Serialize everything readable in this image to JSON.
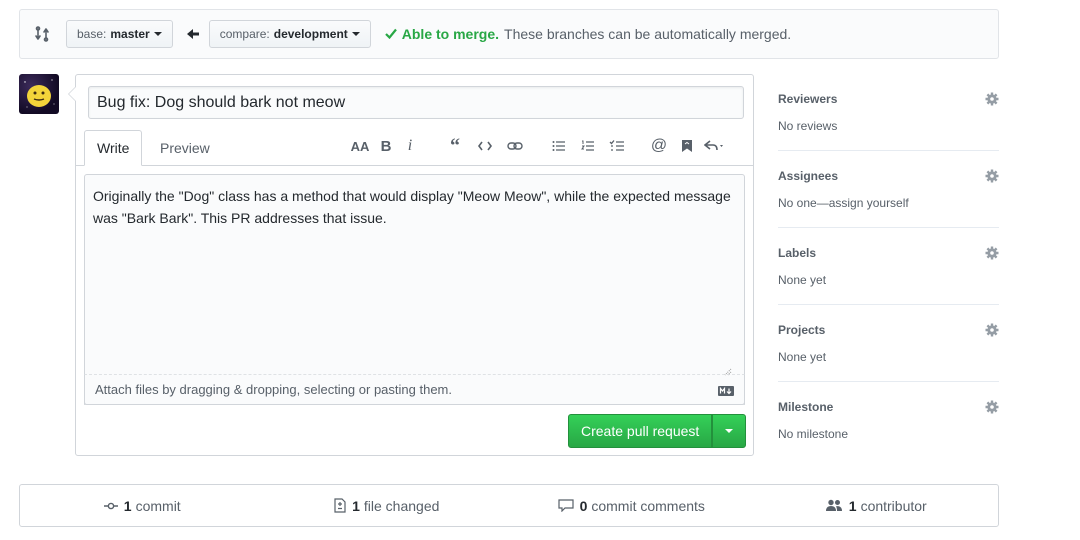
{
  "compare": {
    "base_label": "base:",
    "base_branch": "master",
    "compare_label": "compare:",
    "compare_branch": "development",
    "status_title": "Able to merge.",
    "status_desc": "These branches can be automatically merged.",
    "status_color": "#28a745"
  },
  "form": {
    "title_value": "Bug fix: Dog should bark not meow",
    "tabs": [
      {
        "label": "Write",
        "active": true
      },
      {
        "label": "Preview",
        "active": false
      }
    ],
    "toolbar": [
      "header-icon",
      "bold-icon",
      "italic-icon",
      "quote-icon",
      "code-icon",
      "link-icon",
      "bullet-list-icon",
      "numbered-list-icon",
      "task-list-icon",
      "mention-icon",
      "saved-reply-icon",
      "reply-icon"
    ],
    "body_text": "Originally the \"Dog\" class has a method that would display \"Meow Meow\", while the expected message was \"Bark Bark\". This PR addresses that issue.",
    "attach_text": "Attach files by dragging & dropping, selecting or pasting them.",
    "create_label": "Create pull request",
    "create_color": "#28a745"
  },
  "sidebar": {
    "sections": [
      {
        "title": "Reviewers",
        "value": "No reviews"
      },
      {
        "title": "Assignees",
        "value": "No one—assign yourself"
      },
      {
        "title": "Labels",
        "value": "None yet"
      },
      {
        "title": "Projects",
        "value": "None yet"
      },
      {
        "title": "Milestone",
        "value": "No milestone"
      }
    ]
  },
  "summary": {
    "commits_count": "1",
    "commits_label": "commit",
    "files_count": "1",
    "files_label": "file changed",
    "comments_count": "0",
    "comments_label": "commit comments",
    "contributors_count": "1",
    "contributors_label": "contributor"
  }
}
